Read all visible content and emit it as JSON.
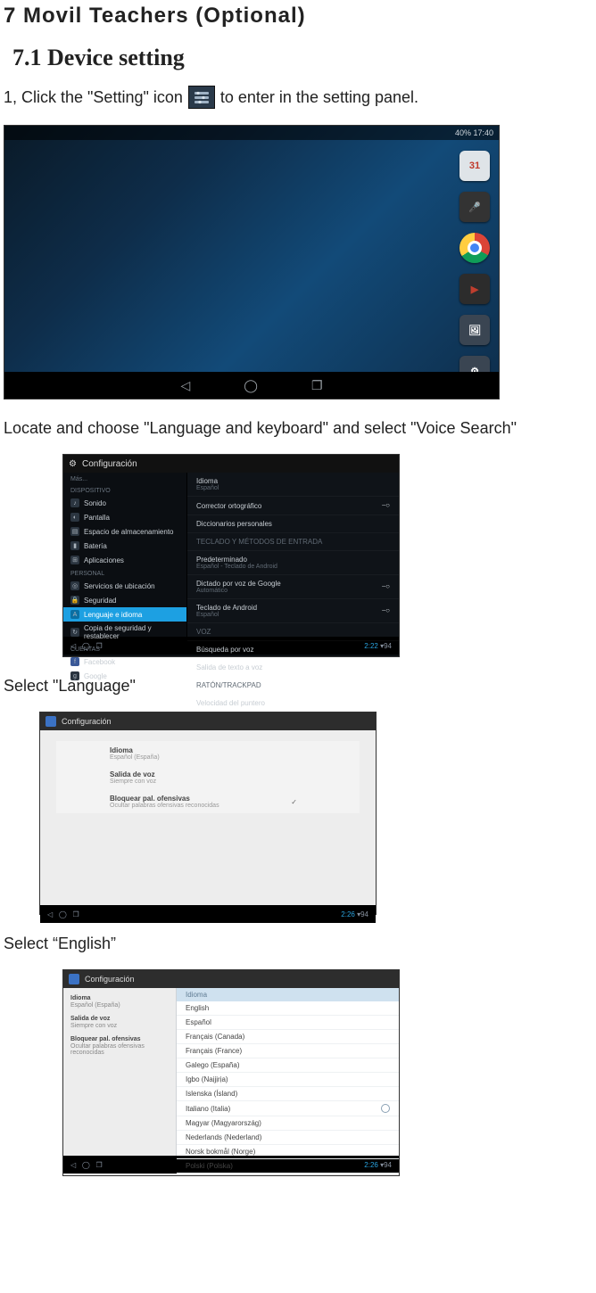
{
  "chapter_title": "7 Movil Teachers (Optional)",
  "section_title": "7.1 Device setting",
  "step1_a": "1, Click the \"Setting\" icon",
  "step1_b": "to enter in the setting panel.",
  "para2": "Locate and choose \"Language and keyboard\" and select \"Voice Search\"",
  "para3": "Select \"Language\"",
  "para4": "Select “English”",
  "shot1": {
    "status_left": "",
    "status_right": "40% 17:40",
    "nav": {
      "back": "◁",
      "home": "◯",
      "recent": "❐"
    },
    "apps": {
      "calendar": "31",
      "mic": "🎤",
      "play": "▶",
      "gallery": "🖼",
      "settings": "⚙"
    }
  },
  "shot2": {
    "title": "Configuración",
    "left_header1": "Más...",
    "left_header2": "DISPOSITIVO",
    "left": {
      "sonido": "Sonido",
      "pantalla": "Pantalla",
      "almac": "Espacio de almacenamiento",
      "bateria": "Batería",
      "apps": "Aplicaciones",
      "hdr_personal": "PERSONAL",
      "ubic": "Servicios de ubicación",
      "seguridad": "Seguridad",
      "idioma": "Lenguaje e idioma",
      "backup": "Copia de seguridad y restablecer",
      "hdr_cuentas": "CUENTAS",
      "facebook": "Facebook",
      "google": "Google"
    },
    "right": {
      "idioma": "Idioma",
      "idioma_sub": "Español",
      "corrector": "Corrector ortográfico",
      "dicc": "Diccionarios personales",
      "hdr_tecl": "TECLADO Y MÉTODOS DE ENTRADA",
      "pred": "Predeterminado",
      "pred_sub": "Español - Teclado de Android",
      "gvoice": "Dictado por voz de Google",
      "gvoice_sub": "Automático",
      "andkb": "Teclado de Android",
      "andkb_sub": "Español",
      "hdr_voz": "VOZ",
      "busq": "Búsqueda por voz",
      "tts": "Salida de texto a voz",
      "hdr_raton": "RATÓN/TRACKPAD",
      "vel": "Velocidad del puntero"
    },
    "foot_time": "2:22",
    "foot_batt": "94"
  },
  "shot3": {
    "title": "Configuración",
    "rows": {
      "idioma": "Idioma",
      "idioma_sub": "Español (España)",
      "salida": "Salida de voz",
      "salida_sub": "Siempre con voz",
      "bloq": "Bloquear pal. ofensivas",
      "bloq_sub": "Ocultar palabras ofensivas reconocidas"
    },
    "foot_time": "2:26",
    "foot_batt": "94"
  },
  "shot4": {
    "title": "Configuración",
    "left": {
      "idioma": "Idioma",
      "idioma_sub": "Español (España)",
      "salida": "Salida de voz",
      "salida_sub": "Siempre con voz",
      "bloq": "Bloquear pal. ofensivas",
      "bloq_sub": "Ocultar palabras ofensivas reconocidas"
    },
    "right_header": "Idioma",
    "langs": [
      "English",
      "Español",
      "Français (Canada)",
      "Français (France)",
      "Galego (España)",
      "Igbo (Naịjịrịa)",
      "Islenska (Ísland)",
      "Italiano (Italia)",
      "Magyar (Magyarország)",
      "Nederlands (Nederland)",
      "Norsk bokmål (Norge)",
      "Polski (Polska)"
    ],
    "foot_time": "2:26",
    "foot_batt": "94"
  }
}
